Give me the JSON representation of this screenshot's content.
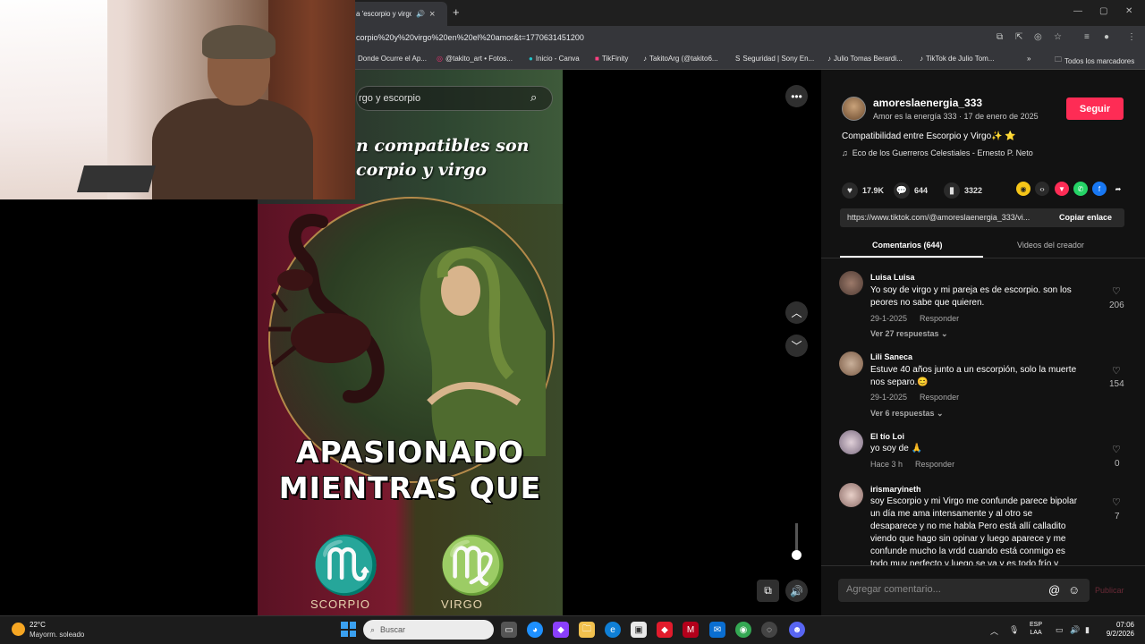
{
  "browser": {
    "tab_title": "a 'escorpio y virgo",
    "tab_close": "×",
    "new_tab": "+",
    "url": "corpio%20y%20virgo%20en%20el%20amor&t=1770631451200",
    "bookmarks": [
      "Donde Ocurre el Ap...",
      "@takito_art • Fotos...",
      "Inicio - Canva",
      "TikFinity",
      "TakitoArg (@takito6...",
      "Seguridad | Sony En...",
      "Julio Tomas Berardi...",
      "TikTok de Julio Tom..."
    ],
    "bookmarks_more": "»",
    "all_bookmarks": "Todos los marcadores"
  },
  "video": {
    "search_text": "rgo y escorpio",
    "caption_top_lines": [
      "n compatibles son",
      "corpio y virgo"
    ],
    "caption_main_lines": [
      "APASIONADO",
      "MIENTRAS QUE"
    ],
    "left_sign_label": "SCORPIO",
    "right_sign_label": "VIRGO",
    "left_sign_symbol": "♏",
    "right_sign_symbol": "♍"
  },
  "panel": {
    "username": "amoreslaenergia_333",
    "bio": "Amor es la energía 333 · 17 de enero de 2025",
    "follow_label": "Seguir",
    "description": "Compatibilidad entre Escorpio y Virgo✨ ⭐",
    "music": "Eco de los Guerreros Celestiales - Ernesto P. Neto",
    "likes": "17.9K",
    "comments": "644",
    "saves": "3322",
    "link_url": "https://www.tiktok.com/@amoreslaenergia_333/vi...",
    "copy_label": "Copiar enlace",
    "tab_comments": "Comentarios (644)",
    "tab_videos": "Videos del creador",
    "comment_placeholder": "Agregar comentario...",
    "publish_label": "Publicar"
  },
  "comments": [
    {
      "name": "Luisa Luisa",
      "text_lines": [
        "Yo soy de virgo y mi pareja es de escorpio. son los",
        "peores no sabe que quieren."
      ],
      "date": "29-1-2025",
      "reply": "Responder",
      "replies": "Ver 27 respuestas ⌄",
      "likes": "206"
    },
    {
      "name": "Lili Saneca",
      "text_lines": [
        "Estuve 40 años junto a un escorpión, solo la muerte",
        "nos separo.😊"
      ],
      "date": "29-1-2025",
      "reply": "Responder",
      "replies": "Ver 6 respuestas ⌄",
      "likes": "154"
    },
    {
      "name": "El tío Loi",
      "text_lines": [
        "yo soy de 🙏"
      ],
      "date": "Hace 3 h",
      "reply": "Responder",
      "replies": "",
      "likes": "0"
    },
    {
      "name": "irismaryineth",
      "text_lines": [
        "soy Escorpio y mi Virgo me confunde parece bipolar",
        "un día me ama intensamente y al otro se",
        "desaparece y no me habla Pero está allí calladito",
        "viendo que hago sin opinar y luego aparece y me",
        "confunde mucho la vrdd cuando está conmigo es",
        "todo muy perfecto y luego se va y es todo frío y"
      ],
      "date": "",
      "reply": "",
      "replies": "",
      "likes": "7"
    }
  ],
  "taskbar": {
    "temp": "22°C",
    "weather": "Mayorm. soleado",
    "search_label": "Buscar",
    "lang_line1": "ESP",
    "lang_line2": "LAA",
    "time": "07:06",
    "date": "9/2/2026"
  },
  "colors": {
    "accent": "#fe2c55",
    "panel_bg": "#121212",
    "video_gold": "#e7c27a"
  }
}
